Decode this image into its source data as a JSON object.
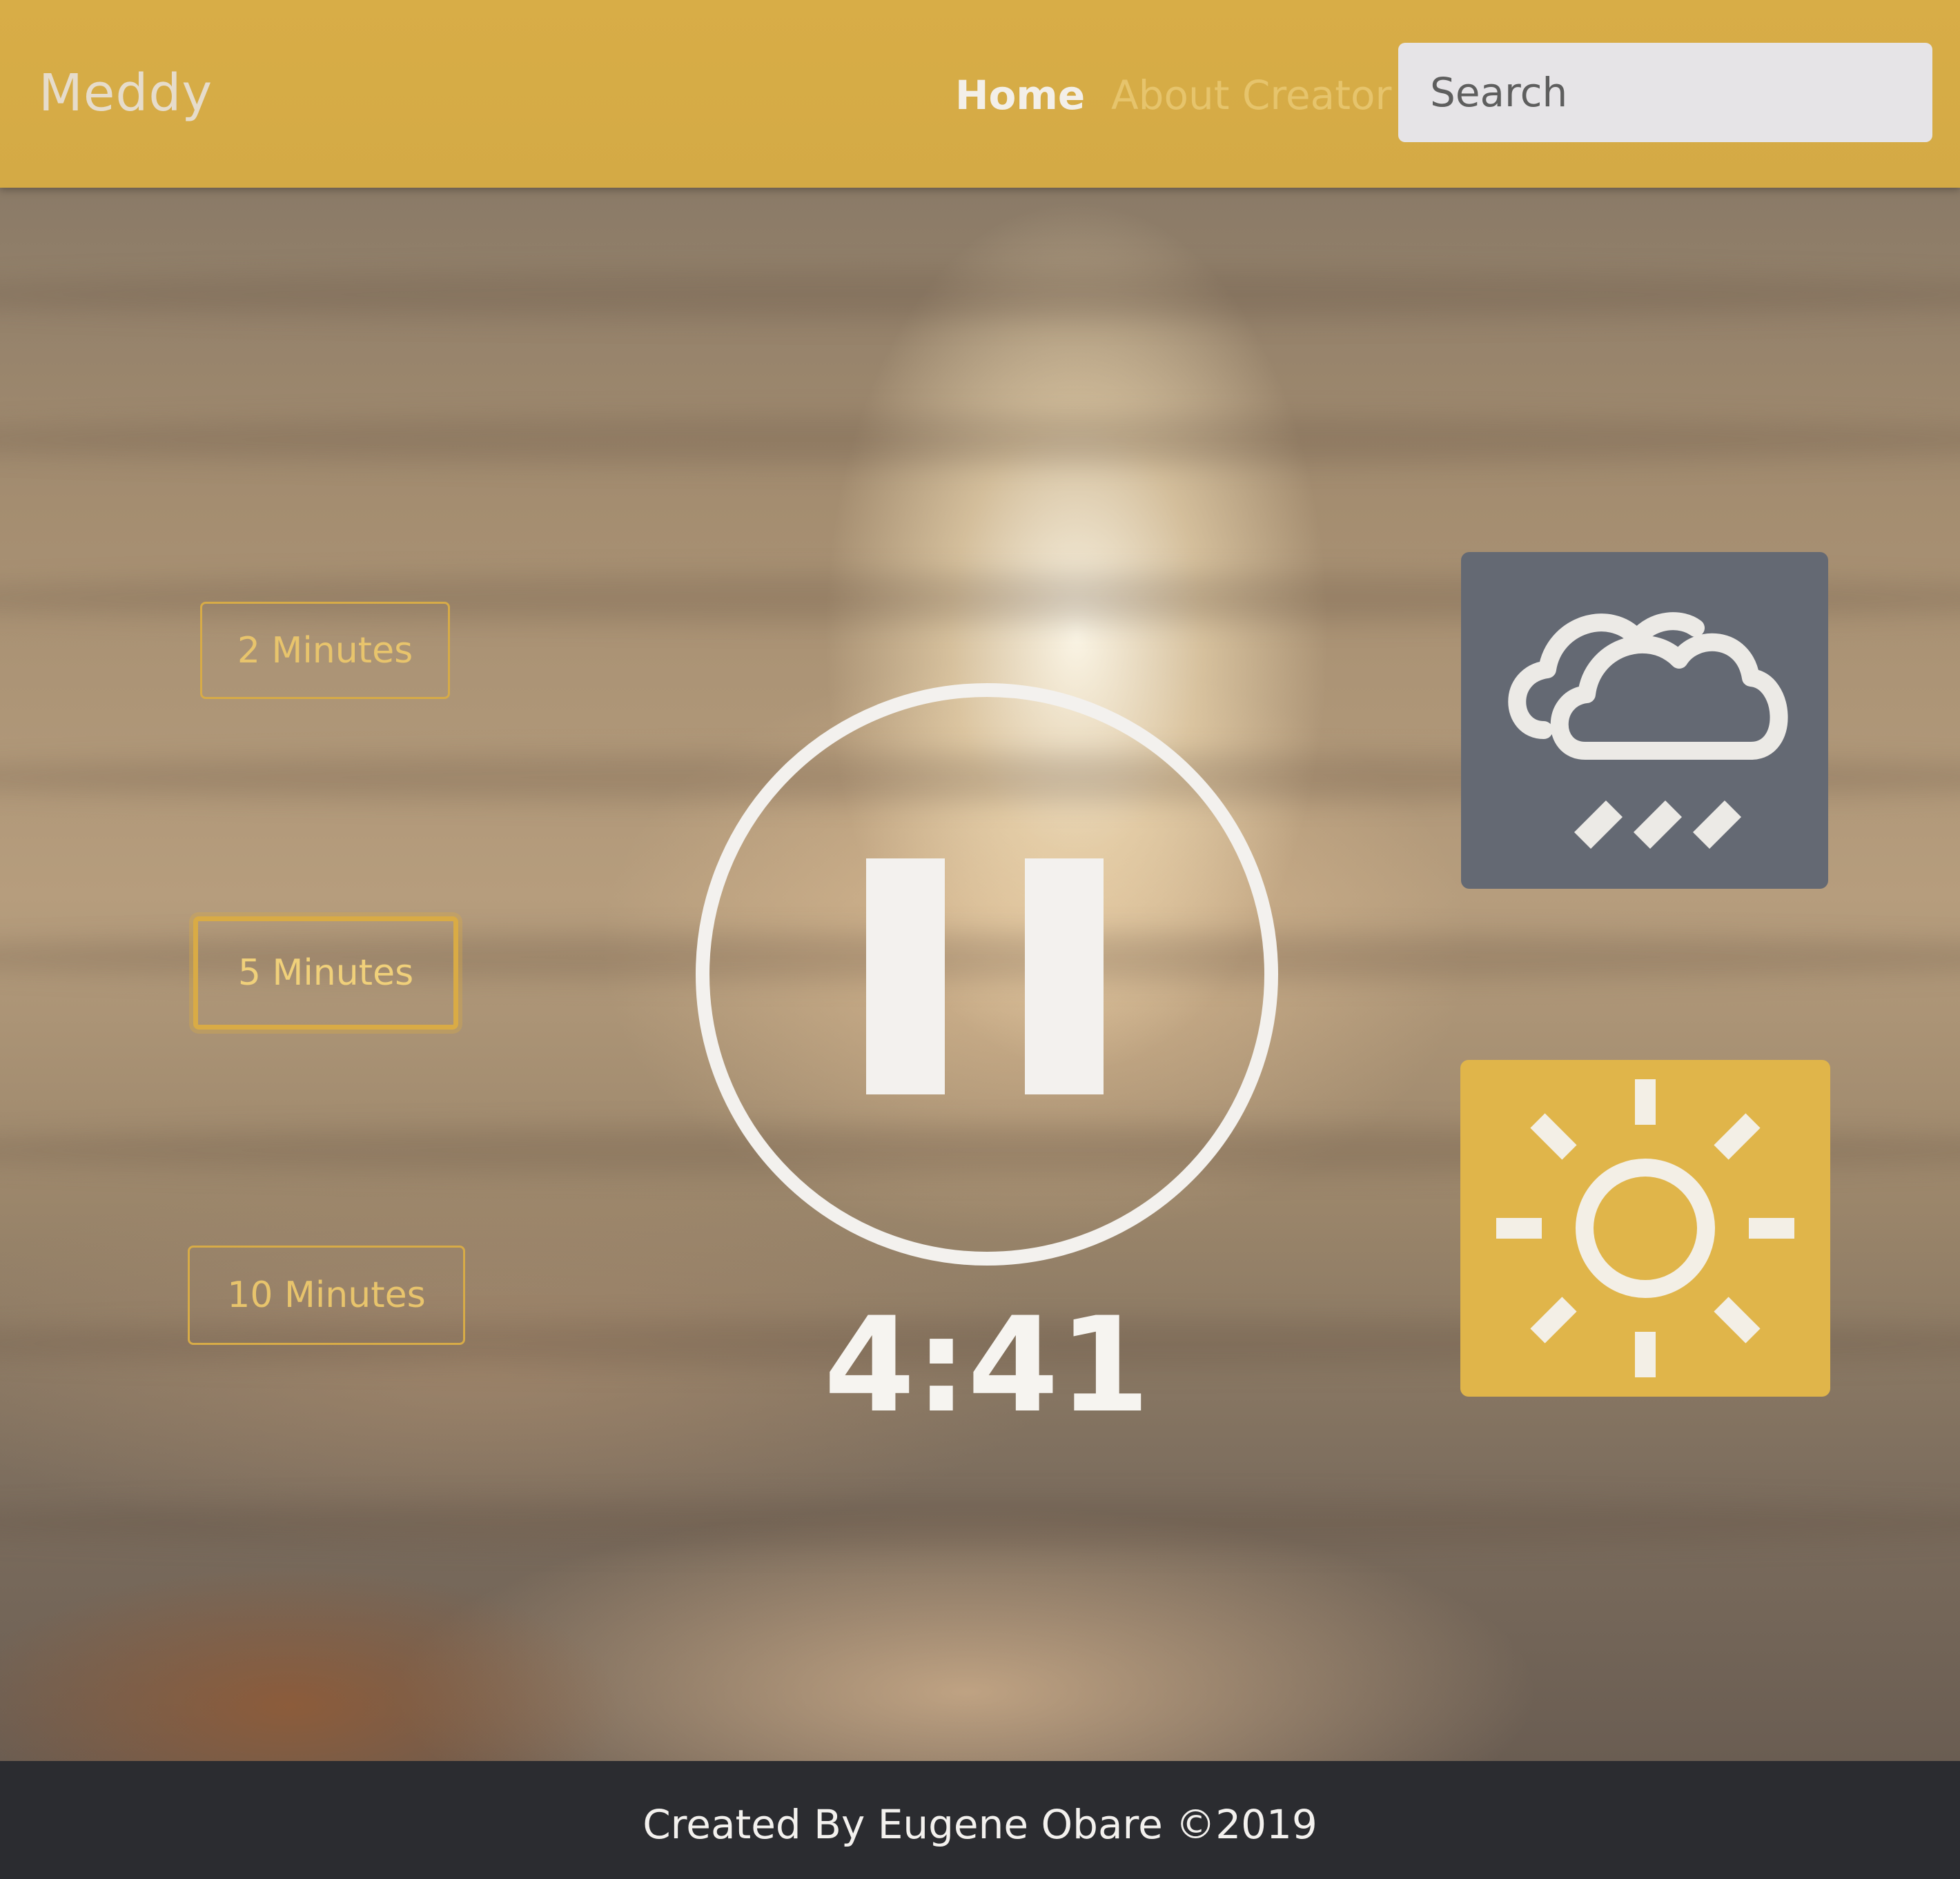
{
  "navbar": {
    "brand": "Meddy",
    "links": [
      {
        "label": "Home",
        "active": true
      },
      {
        "label": "About Creator",
        "active": false
      }
    ],
    "search_placeholder": "Search",
    "background_color": "#d8ad47"
  },
  "durations": [
    {
      "label": "2 Minutes",
      "selected": false
    },
    {
      "label": "5 Minutes",
      "selected": true
    },
    {
      "label": "10 Minutes",
      "selected": false
    }
  ],
  "player": {
    "control_icon": "pause-icon",
    "timer": "4:41"
  },
  "sounds": [
    {
      "name": "rain",
      "icon": "rain-cloud-icon",
      "color": "#646973"
    },
    {
      "name": "summer",
      "icon": "sun-icon",
      "color": "#e0b54a"
    }
  ],
  "footer": {
    "text": "Created By Eugene Obare ©2019",
    "background_color": "#2b2c30"
  },
  "accent_color": "#d7ab47"
}
